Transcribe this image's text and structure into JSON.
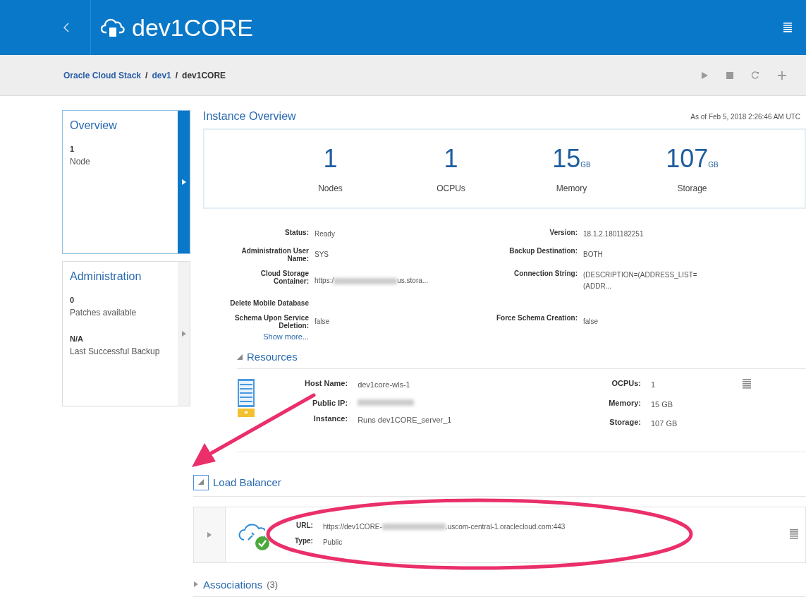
{
  "header": {
    "title": "dev1CORE"
  },
  "breadcrumb": [
    {
      "label": "Oracle Cloud Stack",
      "link": true,
      "separator": "/"
    },
    {
      "label": "dev1",
      "link": true,
      "separator": "/"
    },
    {
      "label": "dev1CORE",
      "link": false
    }
  ],
  "sidebar": [
    {
      "title": "Overview",
      "selected": true,
      "stats": [
        {
          "value": "1",
          "label": "Node"
        }
      ]
    },
    {
      "title": "Administration",
      "selected": false,
      "stats": [
        {
          "value": "0",
          "label": "Patches available"
        },
        {
          "value": "N/A",
          "label": "Last Successful Backup"
        }
      ]
    }
  ],
  "overview": {
    "title": "Instance Overview",
    "timestamp": "As of Feb 5, 2018 2:26:46 AM UTC",
    "metrics": [
      {
        "value": "1",
        "label": "Nodes"
      },
      {
        "value": "1",
        "label": "OCPUs"
      },
      {
        "value": "15",
        "unit": "GB",
        "label": "Memory"
      },
      {
        "value": "107",
        "unit": "GB",
        "label": "Storage"
      }
    ],
    "rows": [
      {
        "left": {
          "label": "Status:",
          "value": "Ready"
        },
        "right": {
          "label": "Version:",
          "value": "18.1.2.1801182251"
        }
      },
      {
        "left": {
          "label": "Administration User Name:",
          "value": "SYS"
        },
        "right": {
          "label": "Backup Destination:",
          "value": "BOTH"
        }
      },
      {
        "left": {
          "label": "Cloud Storage Container:",
          "value": "https:/",
          "redacted": true,
          "value_end": "us.stora..."
        },
        "right": {
          "label": "Connection String:",
          "value": "(DESCRIPTION=(ADDRESS_LIST=(ADDR..."
        }
      },
      {
        "left": {
          "label": "Delete Mobile Database"
        }
      },
      {
        "left": {
          "label": "Schema Upon Service Deletion:",
          "value": "false"
        },
        "right": {
          "label": "Force Schema Creation:",
          "value": "false"
        }
      }
    ],
    "show_more": "Show more..."
  },
  "resources": {
    "title": "Resources",
    "expanded": true,
    "items": [
      {
        "kind": "server",
        "left": [
          {
            "label": "Host Name:",
            "value": "dev1core-wls-1"
          },
          {
            "label": "Public IP:",
            "redacted": true
          },
          {
            "label": "Instance:",
            "value": "Runs dev1CORE_server_1"
          }
        ],
        "right": [
          {
            "label": "OCPUs:",
            "value": "1"
          },
          {
            "label": "Memory:",
            "value": "15 GB"
          },
          {
            "label": "Storage:",
            "value": "107 GB"
          }
        ]
      }
    ]
  },
  "load_balancer": {
    "title": "Load Balancer",
    "expanded": true,
    "items": [
      {
        "kind": "cloud",
        "expanded": false,
        "healthy": true,
        "fields": [
          {
            "label": "URL:",
            "value": "https://dev1CORE-",
            "redacted": true,
            "value_end": ".uscom-central-1.oraclecloud.com:443"
          },
          {
            "label": "Type:",
            "value": "Public"
          }
        ]
      }
    ]
  },
  "associations": {
    "title": "Associations",
    "count": "(3)",
    "expanded": false
  }
}
